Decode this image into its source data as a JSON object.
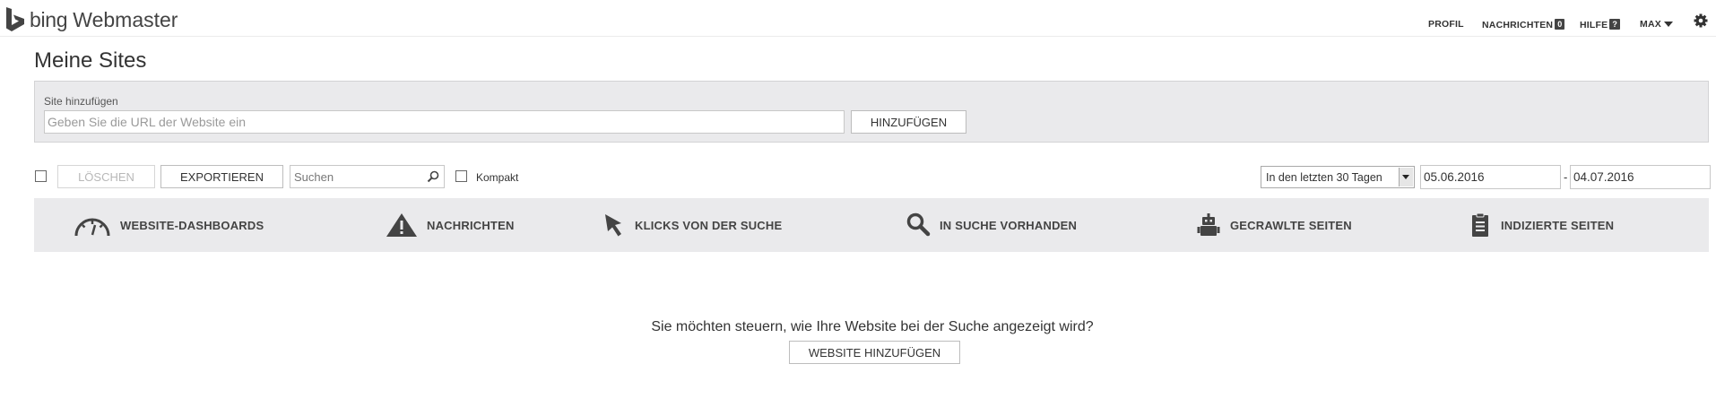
{
  "header": {
    "logo_bing": "bing",
    "logo_product": "Webmaster",
    "nav": {
      "profile": "PROFIL",
      "messages": "NACHRICHTEN",
      "messages_count": "0",
      "help": "HILFE",
      "help_badge": "?",
      "user": "MAX"
    },
    "icons": {
      "logo": "bing-logo-icon",
      "settings": "gear-icon",
      "user_menu": "caret-down-icon"
    }
  },
  "page": {
    "title": "Meine Sites"
  },
  "add_site": {
    "label": "Site hinzufügen",
    "placeholder": "Geben Sie die URL der Website ein",
    "button": "HINZUFÜGEN"
  },
  "toolbar": {
    "delete": "LÖSCHEN",
    "export": "EXPORTIEREN",
    "search_placeholder": "Suchen",
    "compact": "Kompakt",
    "range": "In den letzten 30 Tagen",
    "date_from": "05.06.2016",
    "date_separator": "-",
    "date_to": "04.07.2016"
  },
  "tabs": [
    {
      "label": "WEBSITE-DASHBOARDS",
      "icon": "gauge-icon"
    },
    {
      "label": "NACHRICHTEN",
      "icon": "warning-icon"
    },
    {
      "label": "KLICKS VON DER SUCHE",
      "icon": "cursor-icon"
    },
    {
      "label": "IN SUCHE VORHANDEN",
      "icon": "magnifier-icon"
    },
    {
      "label": "GECRAWLTE SEITEN",
      "icon": "robot-icon"
    },
    {
      "label": "INDIZIERTE SEITEN",
      "icon": "document-icon"
    }
  ],
  "empty_state": {
    "text": "Sie möchten steuern, wie Ihre Website bei der Suche angezeigt wird?",
    "button": "WEBSITE HINZUFÜGEN"
  },
  "colors": {
    "panel_bg": "#eaeaec",
    "text": "#333333",
    "icon": "#444444"
  }
}
